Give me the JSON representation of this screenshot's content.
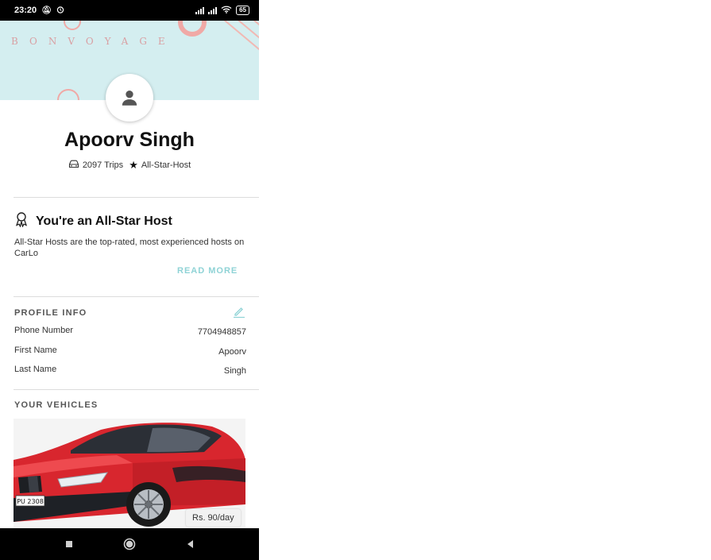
{
  "status_bar": {
    "time": "23:20",
    "battery": "65"
  },
  "cover": {
    "brand_text": "BONVOYAGE"
  },
  "profile": {
    "name": "Apoorv Singh",
    "trips": "2097 Trips",
    "badge": "All-Star-Host"
  },
  "allstar": {
    "title": "You're an All-Star Host",
    "description": "All-Star Hosts are the top-rated, most experienced hosts on CarLo",
    "read_more": "READ MORE"
  },
  "profile_info": {
    "heading": "PROFILE INFO",
    "rows": [
      {
        "label": "Phone Number",
        "value": "7704948857"
      },
      {
        "label": "First Name",
        "value": "Apoorv"
      },
      {
        "label": "Last Name",
        "value": "Singh"
      }
    ]
  },
  "vehicles": {
    "heading": "YOUR VEHICLES",
    "items": [
      {
        "plate": "PU 2308",
        "price": "Rs. 90/day"
      }
    ]
  },
  "colors": {
    "accent": "#8fd3d6",
    "cover_bg": "#d4eef0",
    "car_red": "#d8262e"
  }
}
